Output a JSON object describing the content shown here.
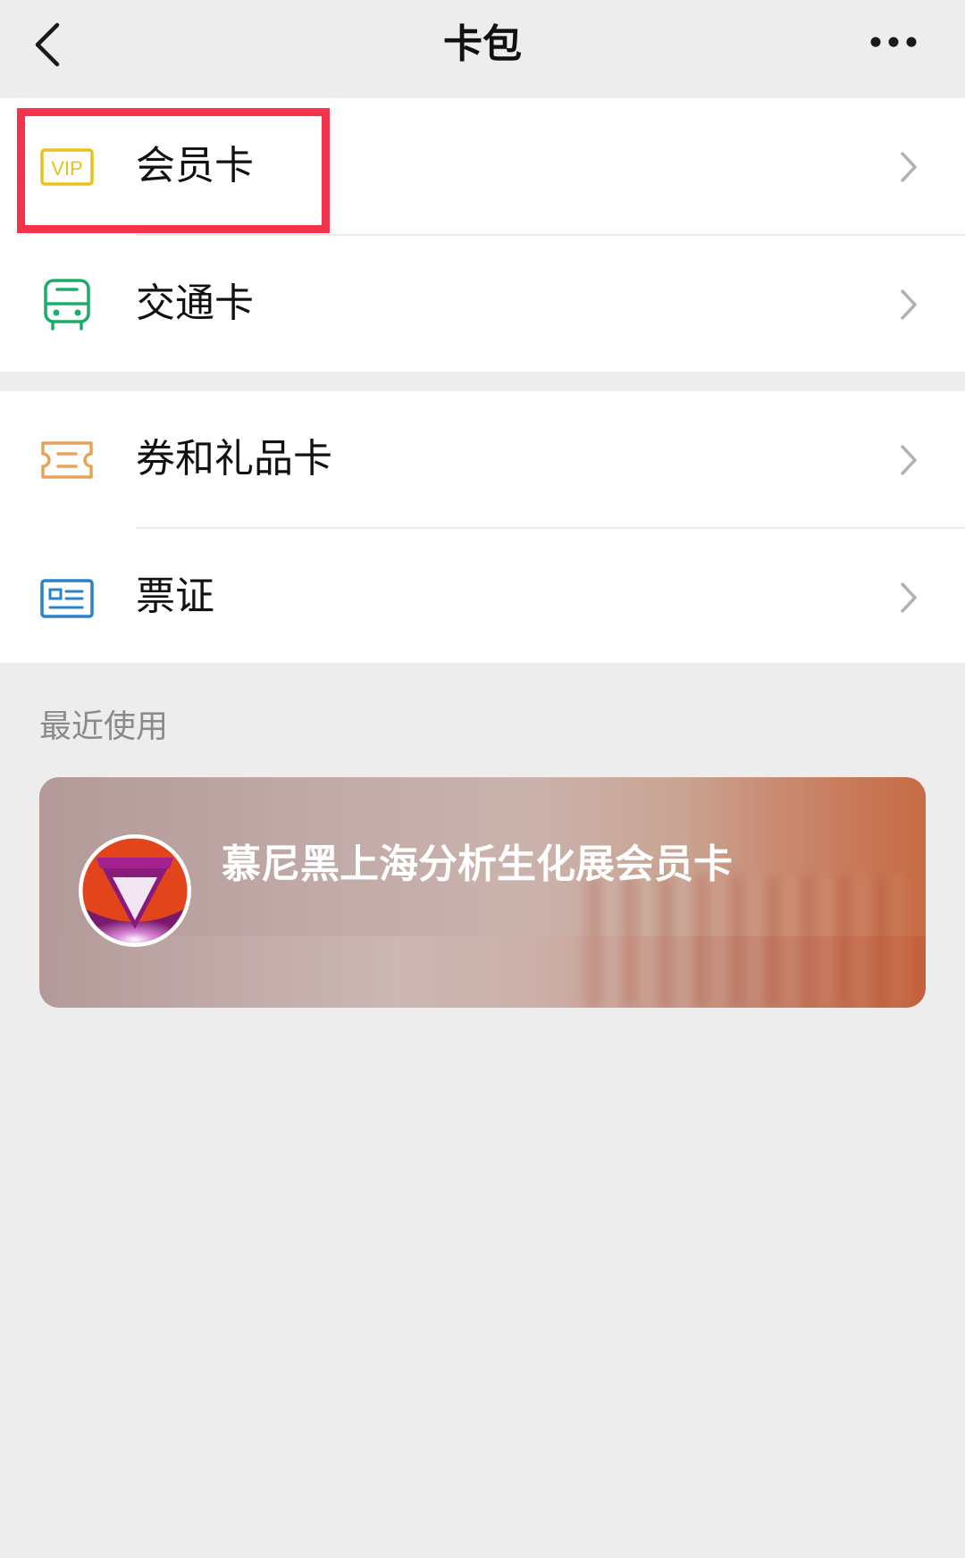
{
  "nav": {
    "title": "卡包",
    "back_icon": "chevron-left-icon",
    "more_icon": "more-horizontal-icon"
  },
  "menu": {
    "member_card": {
      "label": "会员卡",
      "icon": "vip-icon",
      "icon_color": "#e8c21c"
    },
    "transit_card": {
      "label": "交通卡",
      "icon": "bus-icon",
      "icon_color": "#1aad68"
    },
    "coupon_gift_card": {
      "label": "券和礼品卡",
      "icon": "ticket-icon",
      "icon_color": "#e8a35a"
    },
    "tickets_ids": {
      "label": "票证",
      "icon": "id-card-icon",
      "icon_color": "#2a82c8"
    }
  },
  "highlight_color": "#f2334b",
  "recent": {
    "section_label": "最近使用",
    "card": {
      "name": "慕尼黑上海分析生化展会员卡",
      "logo_icon": "analytica-logo-icon"
    }
  }
}
